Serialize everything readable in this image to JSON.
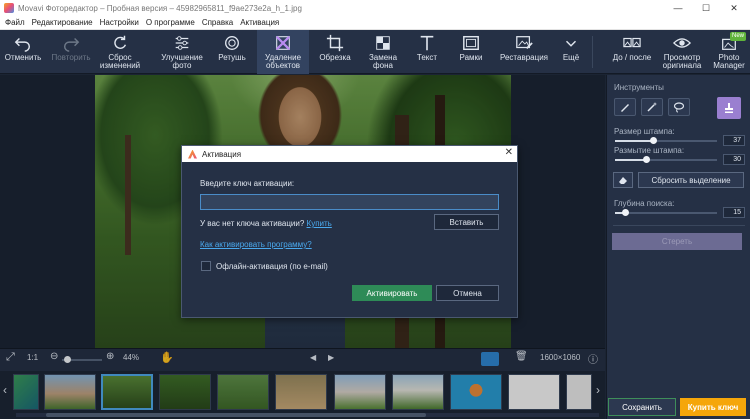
{
  "window": {
    "title": "Movavi Фоторедактор – Пробная версия – 45982965811_f9ae273e2a_h_1.jpg",
    "min": "—",
    "max": "☐",
    "close": "✕"
  },
  "menu": [
    "Файл",
    "Редактирование",
    "Настройки",
    "О программе",
    "Справка",
    "Активация"
  ],
  "toolbar": {
    "undo": "Отменить",
    "redo": "Повторить",
    "reset": "Сброс\nизменений",
    "enhance": "Улучшение\nфото",
    "retouch": "Ретушь",
    "remove_objects": "Удаление\nобъектов",
    "crop": "Обрезка",
    "replace_bg": "Замена\nфона",
    "text": "Текст",
    "frames": "Рамки",
    "restore": "Реставрация",
    "more": "Ещё",
    "before_after": "До / после",
    "view_original": "Просмотр\nоригинала",
    "photo_manager": "Photo\nManager",
    "new_badge": "New"
  },
  "panel": {
    "tools_title": "Инструменты",
    "stamp_size_label": "Размер штампа:",
    "stamp_size_value": "37",
    "stamp_size_level": 0.37,
    "stamp_blur_label": "Размытие штампа:",
    "stamp_blur_value": "30",
    "stamp_blur_level": 0.3,
    "reset_selection": "Сбросить выделение",
    "search_depth_label": "Глубина поиска:",
    "search_depth_value": "15",
    "search_depth_level": 0.1,
    "erase": "Стереть"
  },
  "bottom": {
    "ratio": "1:1",
    "zoom": "44%",
    "size": "1600×1060"
  },
  "buttons": {
    "save": "Сохранить",
    "buy": "Купить ключ"
  },
  "dialog": {
    "title": "Активация",
    "prompt": "Введите ключ активации:",
    "key_value": "",
    "no_key_text": "У вас нет ключа активации?",
    "buy_link": "Купить",
    "paste": "Вставить",
    "how_link": "Как активировать программу?",
    "offline": "Офлайн-активация (по e-mail)",
    "activate": "Активировать",
    "cancel": "Отмена"
  },
  "colors": {
    "accent_blue": "#4aa9ee",
    "activate_green": "#2e8b57",
    "buy_orange": "#f5a60a",
    "stamp_tool_purple": "#9a7fd0"
  }
}
